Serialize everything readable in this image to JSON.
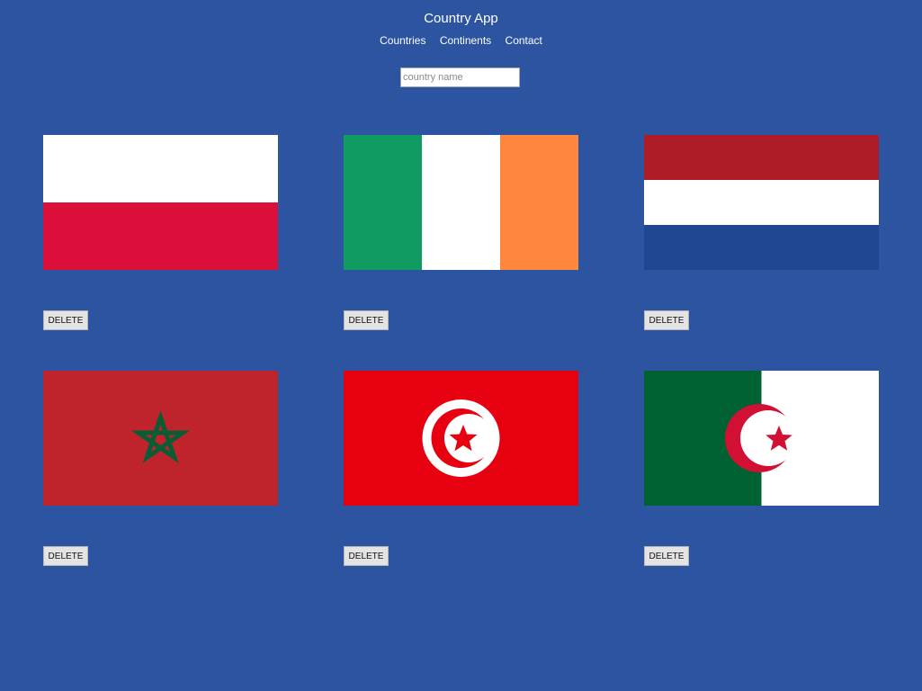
{
  "header": {
    "title": "Country App",
    "nav": [
      "Countries",
      "Continents",
      "Contact"
    ]
  },
  "search": {
    "placeholder": "country name",
    "value": ""
  },
  "countries": [
    {
      "flag_icon": "poland-flag-icon",
      "delete_label": "DELETE",
      "colors": [
        "#ffffff",
        "#dc143c"
      ]
    },
    {
      "flag_icon": "ireland-flag-icon",
      "delete_label": "DELETE",
      "colors": [
        "#169b62",
        "#ffffff",
        "#ff883e"
      ]
    },
    {
      "flag_icon": "netherlands-flag-icon",
      "delete_label": "DELETE",
      "colors": [
        "#ae1c28",
        "#ffffff",
        "#21468b"
      ]
    },
    {
      "flag_icon": "morocco-flag-icon",
      "delete_label": "DELETE",
      "colors": [
        "#c1272d",
        "#006233"
      ]
    },
    {
      "flag_icon": "tunisia-flag-icon",
      "delete_label": "DELETE",
      "colors": [
        "#e70013",
        "#ffffff"
      ]
    },
    {
      "flag_icon": "algeria-flag-icon",
      "delete_label": "DELETE",
      "colors": [
        "#006633",
        "#ffffff",
        "#d21034"
      ]
    }
  ],
  "colors": {
    "background": "#2d54a0",
    "text": "#ffffff"
  }
}
